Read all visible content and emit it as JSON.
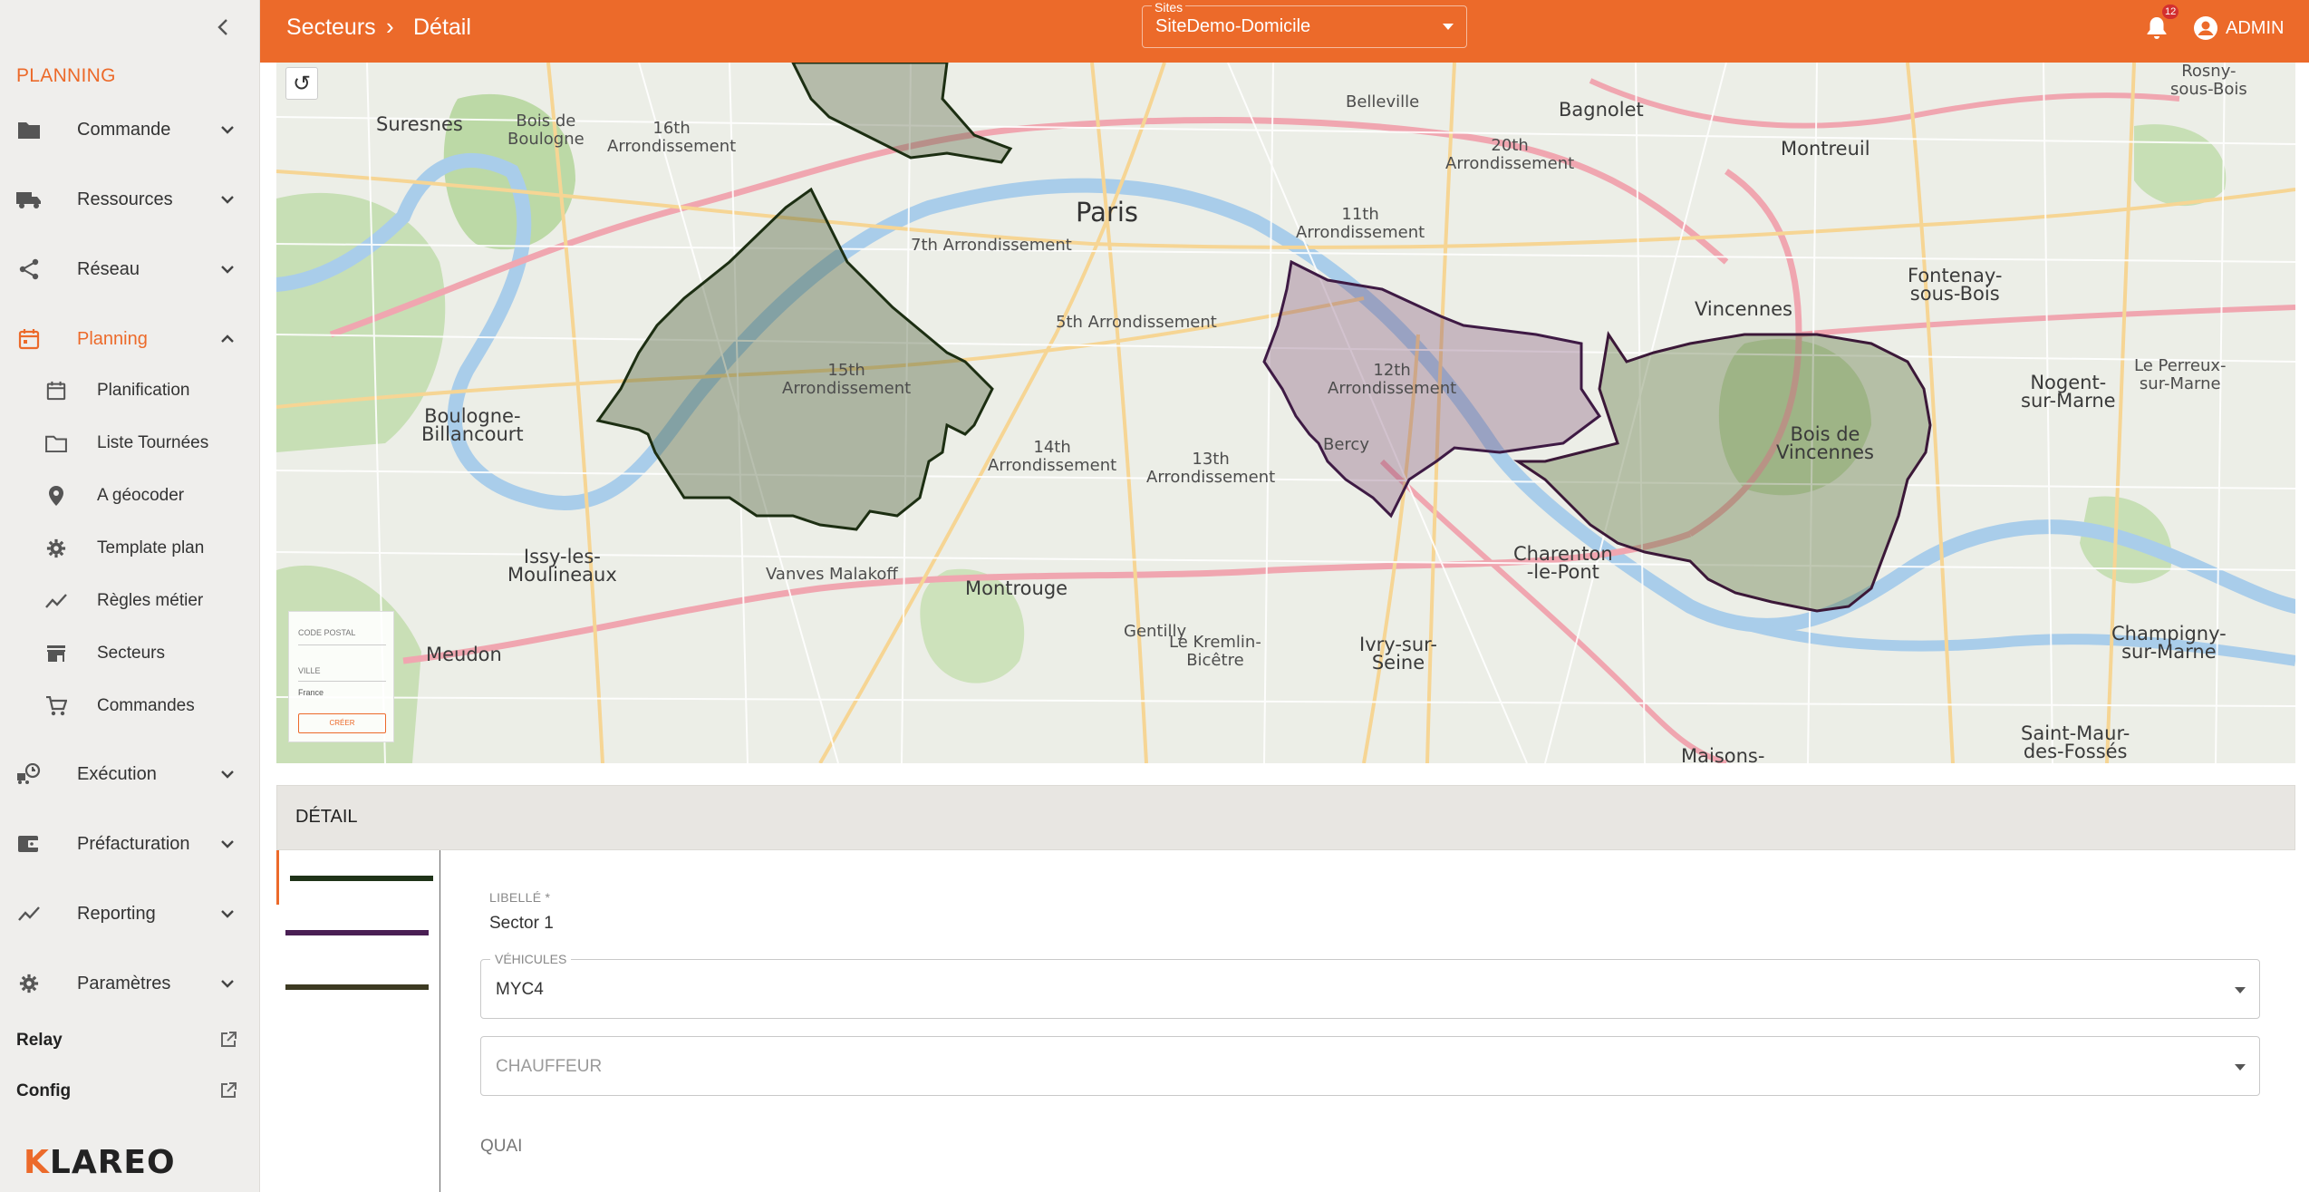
{
  "sidebar": {
    "section_title": "PLANNING",
    "items": [
      {
        "label": "Commande",
        "icon": "folder-icon"
      },
      {
        "label": "Ressources",
        "icon": "truck-icon"
      },
      {
        "label": "Réseau",
        "icon": "share-icon"
      },
      {
        "label": "Planning",
        "icon": "calendar-icon",
        "active": true
      }
    ],
    "sub_items": [
      {
        "label": "Planification",
        "icon": "calendar-icon"
      },
      {
        "label": "Liste Tournées",
        "icon": "folder-outline-icon"
      },
      {
        "label": "A géocoder",
        "icon": "location-pin-icon"
      },
      {
        "label": "Template plan",
        "icon": "gear-icon"
      },
      {
        "label": "Règles métier",
        "icon": "trend-line-icon"
      },
      {
        "label": "Secteurs",
        "icon": "store-icon"
      },
      {
        "label": "Commandes",
        "icon": "cart-icon"
      }
    ],
    "more_items": [
      {
        "label": "Exécution",
        "icon": "schedule-truck-icon"
      },
      {
        "label": "Préfacturation",
        "icon": "wallet-icon"
      },
      {
        "label": "Reporting",
        "icon": "trend-line-icon"
      },
      {
        "label": "Paramètres",
        "icon": "gear-icon"
      }
    ],
    "external_links": [
      {
        "label": "Relay"
      },
      {
        "label": "Config"
      }
    ],
    "logo": {
      "first": "K",
      "rest": "LAREO"
    }
  },
  "topbar": {
    "breadcrumb": [
      "Secteurs",
      "Détail"
    ],
    "breadcrumb_separator": "›",
    "site_selector": {
      "label": "Sites",
      "value": "SiteDemo-Domicile"
    },
    "notifications_count": "12",
    "user": "ADMIN",
    "accent_color": "#ec6a2a"
  },
  "map": {
    "labels": {
      "paris": "Paris",
      "suresnes": "Suresnes",
      "bagnolet": "Bagnolet",
      "montreuil": "Montreuil",
      "vincennes": "Vincennes",
      "boulogne": "Boulogne-\nBillancourt",
      "issy": "Issy-les-\nMoulineaux",
      "montrouge": "Montrouge",
      "ivry": "Ivry-sur-\nSeine",
      "charenton": "Charenton\n-le-Pont",
      "meudon": "Meudon",
      "gentilly": "Gentilly",
      "fontenay": "Fontenay-\nsous-Bois",
      "nogent": "Nogent-\nsur-Marne",
      "champigny": "Champigny-\nsur-Marne",
      "saint_maur": "Saint-Maur-\ndes-Fossés",
      "vanves": "Vanves",
      "malakoff": "Malakoff",
      "arr15": "15th\nArrondissement",
      "arr12": "12th\nArrondissement",
      "arr14": "14th\nArrondissement",
      "arr13": "13th\nArrondissement",
      "arr16": "16th\nArrondissement",
      "arr20": "20th\nArrondissement",
      "arr11": "11th\nArrondissement",
      "arr5": "5th Arrondissement",
      "arr7": "7th Arrondissement",
      "bois_vincennes": "Bois de\nVincennes",
      "bois_boulogne": "Bois de\nBoulogne",
      "bercy": "Bercy",
      "belleville": "Belleville",
      "maisons": "Maisons-",
      "kremlin": "Le Kremlin-\nBicêtre",
      "rosny": "Rosny-\nsous-Bois",
      "perreux": "Le Perreux-\nsur-Marne"
    },
    "mini_form": {
      "postal_code": "CODE POSTAL",
      "city": "VILLE",
      "country": "France",
      "create": "CRÉER"
    },
    "sector_colors": [
      "#1c2e12",
      "#3e1a44",
      "#2a3a18"
    ]
  },
  "detail": {
    "header": "DÉTAIL",
    "sectors": [
      {
        "color": "#1f3318",
        "selected": true
      },
      {
        "color": "#4a1f54"
      },
      {
        "color": "#3d3a22"
      }
    ],
    "label_field": {
      "label": "LIBELLÉ *",
      "value": "Sector 1"
    },
    "vehicles": {
      "label": "VÉHICULES",
      "value": "MYC4"
    },
    "driver": {
      "placeholder": "CHAUFFEUR"
    },
    "quai": "QUAI"
  }
}
